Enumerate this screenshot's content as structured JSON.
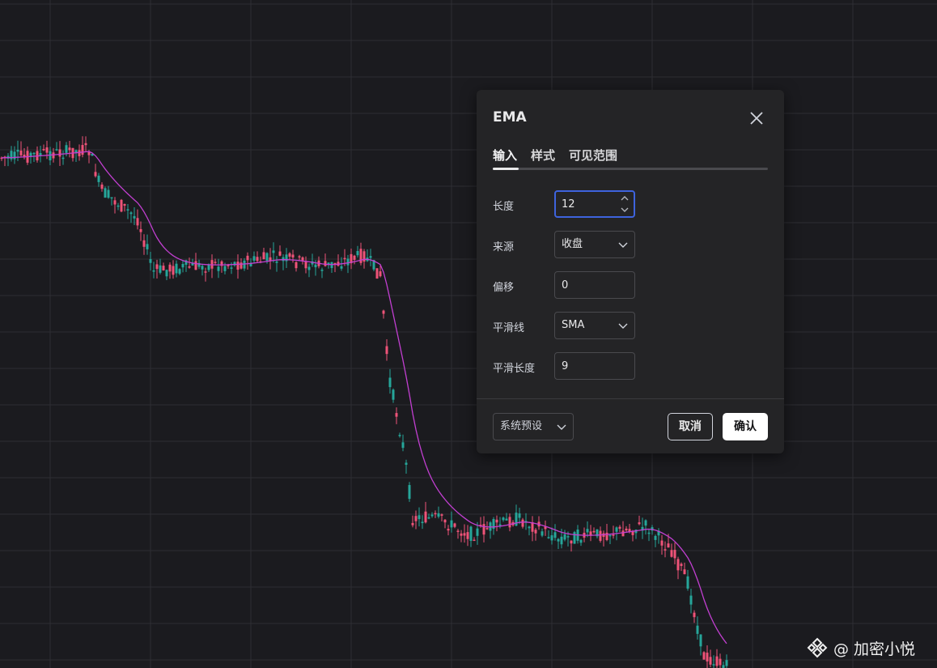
{
  "chart_data": {
    "type": "candlestick",
    "note_series": "EMA overlay line drawn in magenta",
    "colors": {
      "up": "#26a69a",
      "down": "#ef5378",
      "ema": "#c23fd1",
      "grid": "#2e2e33",
      "background": "#1b1b1f"
    }
  },
  "dialog": {
    "title": "EMA",
    "tabs": [
      {
        "label": "输入"
      },
      {
        "label": "样式"
      },
      {
        "label": "可见范围"
      }
    ],
    "fields": {
      "length": {
        "label": "长度",
        "value": "12"
      },
      "source": {
        "label": "来源",
        "value": "收盘"
      },
      "offset": {
        "label": "偏移",
        "value": "0"
      },
      "smoothing": {
        "label": "平滑线",
        "value": "SMA"
      },
      "smoothing_length": {
        "label": "平滑长度",
        "value": "9"
      }
    },
    "footer": {
      "preset": "系统预设",
      "cancel": "取消",
      "ok": "确认"
    }
  },
  "watermark": {
    "text": "@ 加密小悦"
  },
  "colors": {
    "accent_focus": "#3e63dd",
    "dialog_bg": "#242426"
  },
  "icons": {
    "close": "close-icon",
    "chevron": "chevron-down-icon",
    "spinner": "spinner-arrows-icon",
    "brand": "binance-logo-icon"
  }
}
